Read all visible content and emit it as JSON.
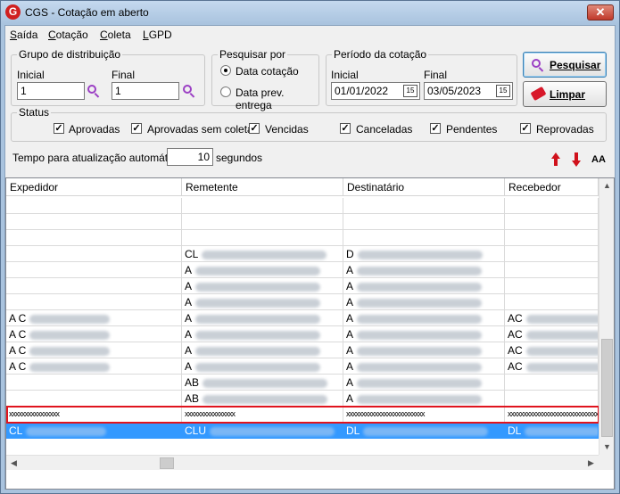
{
  "window": {
    "app_icon": "G",
    "title": "CGS - Cotação em aberto",
    "close_icon": "close-icon"
  },
  "menu": {
    "items": [
      {
        "first": "S",
        "rest": "aída"
      },
      {
        "first": "C",
        "rest": "otação"
      },
      {
        "first": "C",
        "rest": "oleta"
      },
      {
        "first": "L",
        "rest": "GPD"
      }
    ]
  },
  "grupo": {
    "label": "Grupo de distribuição",
    "inicial_label": "Inicial",
    "inicial_value": "1",
    "final_label": "Final",
    "final_value": "1"
  },
  "pesquisar_por": {
    "label": "Pesquisar por",
    "options": [
      "Data cotação",
      "Data prev. entrega"
    ],
    "selected": 0
  },
  "periodo": {
    "label": "Período da cotação",
    "inicial_label": "Inicial",
    "inicial_value": "01/01/2022",
    "final_label": "Final",
    "final_value": "03/05/2023",
    "calendar_glyph": "15"
  },
  "buttons": {
    "pesquisar": "Pesquisar",
    "limpar": "Limpar"
  },
  "status": {
    "label": "Status",
    "items": [
      "Aprovadas",
      "Aprovadas sem coleta",
      "Vencidas",
      "Canceladas",
      "Pendentes",
      "Reprovadas"
    ],
    "check_glyph": "✓"
  },
  "refresh": {
    "label": "Tempo para atualização automática",
    "value": "10",
    "unit": "segundos"
  },
  "toolbar_icons": {
    "font_icon": "AA"
  },
  "grid": {
    "columns": [
      "Expedidor",
      "Remetente",
      "Destinatário",
      "Recebedor"
    ],
    "rows": [
      [
        "",
        "",
        "",
        ""
      ],
      [
        "",
        "",
        "",
        ""
      ],
      [
        "",
        "",
        "",
        ""
      ],
      [
        "",
        "CL",
        "D",
        ""
      ],
      [
        "",
        "A",
        "A",
        ""
      ],
      [
        "",
        "A",
        "A",
        ""
      ],
      [
        "",
        "A",
        "A",
        ""
      ],
      [
        "A C",
        "A",
        "A",
        "AC"
      ],
      [
        "A C",
        "A",
        "A",
        "AC"
      ],
      [
        "A C",
        "A",
        "A",
        "AC"
      ],
      [
        "A C",
        "A",
        "A",
        "AC"
      ],
      [
        "",
        "AB",
        "A",
        ""
      ],
      [
        "",
        "AB",
        "A",
        ""
      ],
      [
        "xxxxxxxxxxxxxxxx",
        "xxxxxxxxxxxxxxxx",
        "xxxxxxxxxxxxxxxxxxxxxxxxx",
        "xxxxxxxxxxxxxxxxxxxxxxxxxxxxxx"
      ],
      [
        "CL",
        "CLU",
        "DL",
        "DL"
      ]
    ]
  }
}
